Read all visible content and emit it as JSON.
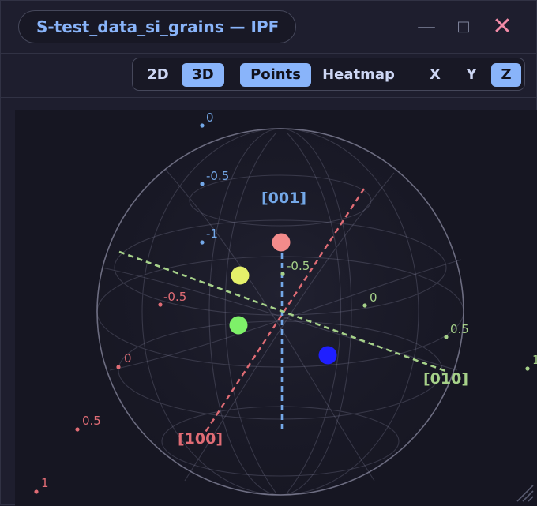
{
  "window": {
    "title": "S-test_data_si_grains — IPF",
    "controls": {
      "minimize": "—",
      "maximize": "□",
      "close": "✕"
    }
  },
  "toolbar": {
    "dim_2d": "2D",
    "dim_3d": "3D",
    "mode_points": "Points",
    "mode_heatmap": "Heatmap",
    "dir_x": "X",
    "dir_y": "Y",
    "dir_z": "Z",
    "active": [
      "3D",
      "Points",
      "Z"
    ]
  },
  "scene": {
    "axes": {
      "x": {
        "label": "[100]",
        "color": "#e06c75"
      },
      "y": {
        "label": "[010]",
        "color": "#a6d189"
      },
      "z": {
        "label": "[001]",
        "color": "#74a8e8"
      }
    },
    "tick_labels": {
      "z": [
        "0",
        "-0.5",
        "-1"
      ],
      "x": [
        "-0.5",
        "0",
        "0.5",
        "1"
      ],
      "y": [
        "-0.5",
        "0",
        "0.5",
        "1"
      ]
    },
    "grain_points": [
      {
        "name": "grain-red",
        "color": "#f38b8b"
      },
      {
        "name": "grain-yellow",
        "color": "#e5f06a"
      },
      {
        "name": "grain-green",
        "color": "#7ef069"
      },
      {
        "name": "grain-blue",
        "color": "#1f1fff"
      }
    ]
  }
}
